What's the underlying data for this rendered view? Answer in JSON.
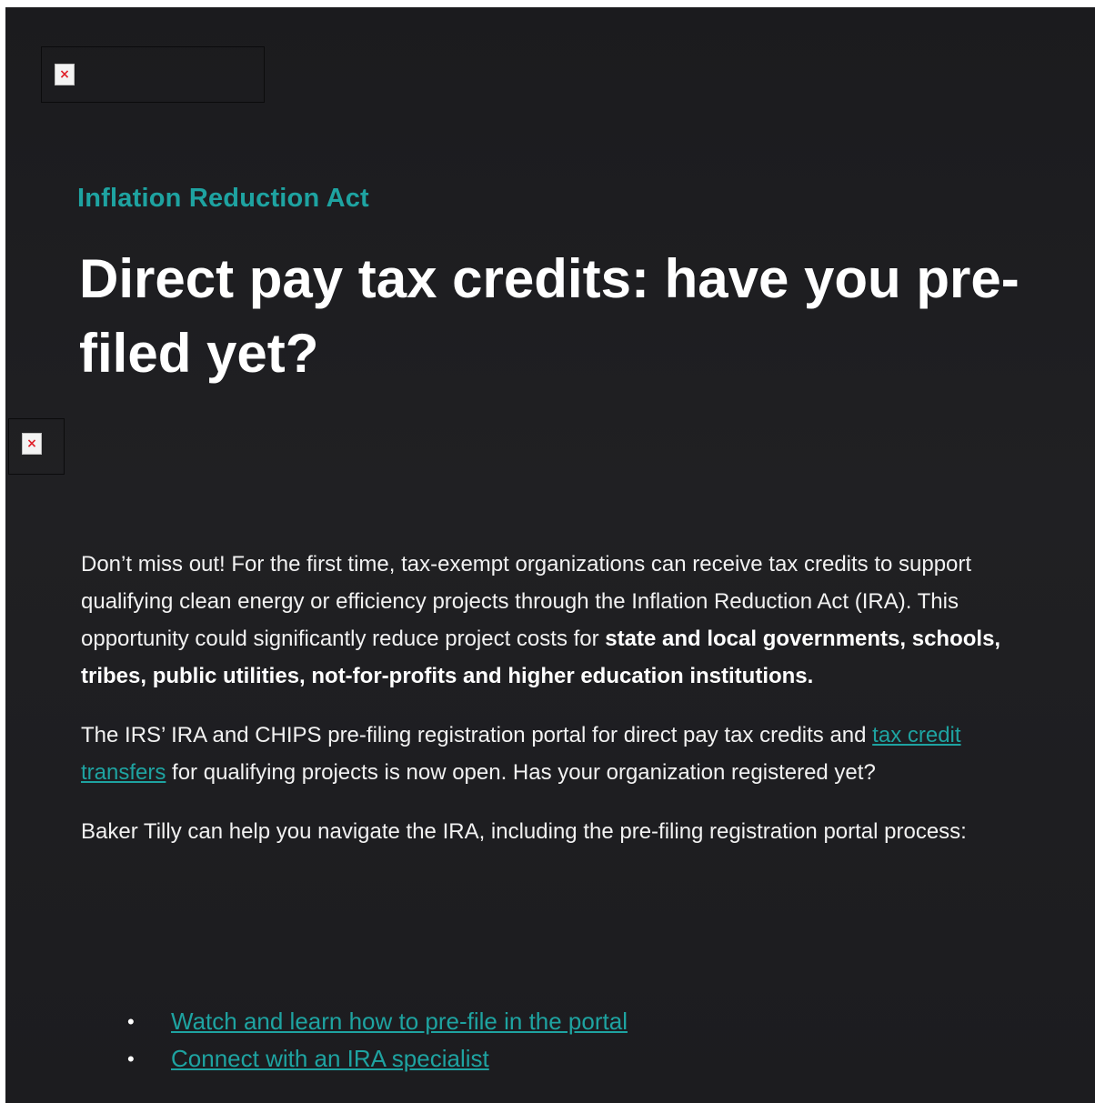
{
  "header": {
    "logo_icon": "broken-image-icon"
  },
  "article": {
    "eyebrow": "Inflation Reduction Act",
    "title": "Direct pay tax credits: have you pre-filed yet?",
    "hero_icon": "broken-image-icon",
    "intro": {
      "text_1": "Don’t miss out! For the first time, tax-exempt organizations can receive tax credits to support qualifying clean energy or efficiency projects through the Inflation Reduction Act (IRA). This opportunity could significantly reduce project costs for ",
      "bold": "state and local governments, schools, tribes, public utilities, not-for-profits and higher education institutions."
    },
    "portal": {
      "text_1": "The IRS’ IRA and CHIPS pre-filing registration portal for direct pay tax credits and ",
      "link": "tax credit transfers",
      "text_2": " for qualifying projects is now open. Has your organization registered yet?"
    },
    "help": "Baker Tilly can help you navigate the IRA, including the pre-filing registration portal process:",
    "links": [
      "Watch and learn how to pre-file in the portal",
      "Connect with an IRA specialist"
    ],
    "bullet_glyph": "•"
  },
  "colors": {
    "accent": "#1ea3a1",
    "background": "#1d1d20",
    "text": "#ffffff"
  }
}
